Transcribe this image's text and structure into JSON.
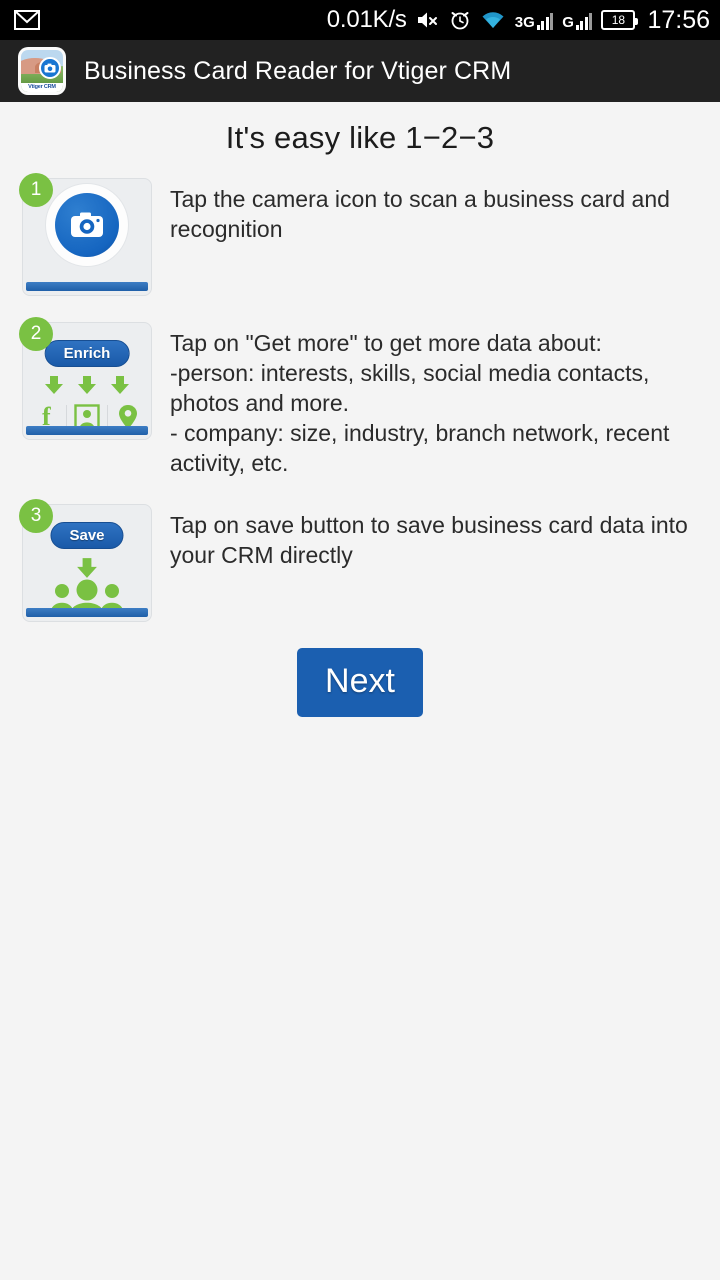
{
  "statusbar": {
    "notification_icon": "gmail-icon",
    "network_speed": "0.01K/s",
    "mute_icon": "volume-mute-icon",
    "alarm_icon": "alarm-clock-icon",
    "wifi_icon": "wifi-icon",
    "sim1_label": "3G",
    "sim2_label": "G",
    "battery_level": "18",
    "clock": "17:56"
  },
  "appbar": {
    "icon_name": "app-icon-vtiger-crm",
    "icon_label": "Vtiger CRM",
    "title": "Business Card Reader for Vtiger CRM"
  },
  "main": {
    "page_title": "It's easy like 1−2−3",
    "steps": [
      {
        "number": "1",
        "icon_name": "camera-button-thumbnail",
        "text": "Tap the camera icon to scan a business card and recognition"
      },
      {
        "number": "2",
        "icon_name": "enrich-button-thumbnail",
        "button_label": "Enrich",
        "sub_icons": [
          "facebook-icon",
          "portrait-icon",
          "map-pin-icon"
        ],
        "text": "Tap on \"Get more\" to get more data about:\n-person: interests, skills, social media contacts, photos and more.\n- company: size, industry, branch network, recent activity, etc."
      },
      {
        "number": "3",
        "icon_name": "save-button-thumbnail",
        "button_label": "Save",
        "sub_icons": [
          "people-group-icon"
        ],
        "text": "Tap on save button to save business card data into your CRM directly"
      }
    ],
    "next_button": "Next"
  },
  "colors": {
    "accent_blue": "#1b5fb0",
    "accent_green": "#7ac143",
    "appbar_bg": "#222222",
    "page_bg": "#f4f4f4"
  }
}
